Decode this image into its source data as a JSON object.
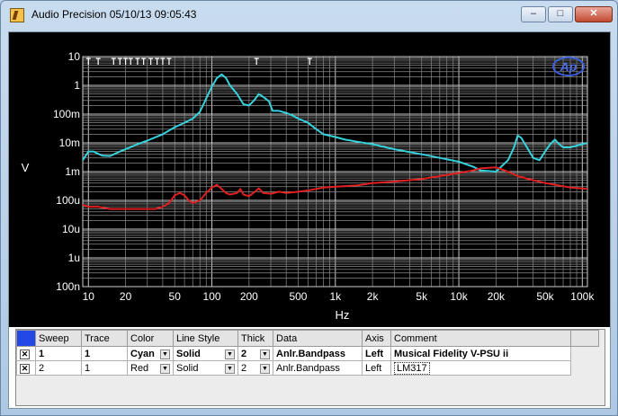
{
  "window": {
    "title": "Audio Precision  05/10/13 09:05:43",
    "minimize_glyph": "–",
    "maximize_glyph": "□",
    "close_glyph": "✕"
  },
  "plot": {
    "logo": "Ap"
  },
  "chart_data": {
    "type": "line",
    "title": "",
    "xlabel": "Hz",
    "ylabel": "V",
    "xscale": "log",
    "yscale": "log",
    "xlim": [
      9,
      110000
    ],
    "ylim": [
      1e-10,
      10
    ],
    "grid": true,
    "background": "#000000",
    "x_ticks": [
      {
        "value": 10,
        "label": "10"
      },
      {
        "value": 20,
        "label": "20"
      },
      {
        "value": 50,
        "label": "50"
      },
      {
        "value": 100,
        "label": "100"
      },
      {
        "value": 200,
        "label": "200"
      },
      {
        "value": 500,
        "label": "500"
      },
      {
        "value": 1000,
        "label": "1k"
      },
      {
        "value": 2000,
        "label": "2k"
      },
      {
        "value": 5000,
        "label": "5k"
      },
      {
        "value": 10000,
        "label": "10k"
      },
      {
        "value": 20000,
        "label": "20k"
      },
      {
        "value": 50000,
        "label": "50k"
      },
      {
        "value": 100000,
        "label": "100k"
      }
    ],
    "y_ticks": [
      {
        "value": 10,
        "label": "10"
      },
      {
        "value": 1,
        "label": "1"
      },
      {
        "value": 0.1,
        "label": "100m"
      },
      {
        "value": 0.01,
        "label": "10m"
      },
      {
        "value": 0.001,
        "label": "1m"
      },
      {
        "value": 0.0001,
        "label": "100u"
      },
      {
        "value": 1e-05,
        "label": "10u"
      },
      {
        "value": 1e-06,
        "label": "1u"
      },
      {
        "value": 1e-07,
        "label": "100n"
      }
    ],
    "markers_x": [
      10,
      12,
      16,
      18,
      20,
      22,
      25,
      28,
      32,
      36,
      40,
      45,
      230,
      620
    ],
    "series": [
      {
        "color": "#36d3dc",
        "points": [
          [
            9,
            0.0025
          ],
          [
            10,
            0.005
          ],
          [
            11,
            0.005
          ],
          [
            12,
            0.0042
          ],
          [
            13,
            0.0036
          ],
          [
            15,
            0.0035
          ],
          [
            17,
            0.0045
          ],
          [
            20,
            0.006
          ],
          [
            25,
            0.009
          ],
          [
            30,
            0.012
          ],
          [
            40,
            0.02
          ],
          [
            50,
            0.035
          ],
          [
            60,
            0.05
          ],
          [
            70,
            0.07
          ],
          [
            80,
            0.12
          ],
          [
            90,
            0.35
          ],
          [
            100,
            0.9
          ],
          [
            110,
            1.8
          ],
          [
            120,
            2.4
          ],
          [
            130,
            1.8
          ],
          [
            140,
            1.0
          ],
          [
            160,
            0.5
          ],
          [
            180,
            0.22
          ],
          [
            200,
            0.2
          ],
          [
            220,
            0.3
          ],
          [
            240,
            0.5
          ],
          [
            260,
            0.4
          ],
          [
            290,
            0.28
          ],
          [
            310,
            0.13
          ],
          [
            350,
            0.13
          ],
          [
            400,
            0.11
          ],
          [
            450,
            0.09
          ],
          [
            500,
            0.07
          ],
          [
            600,
            0.05
          ],
          [
            700,
            0.03
          ],
          [
            800,
            0.02
          ],
          [
            1000,
            0.016
          ],
          [
            1200,
            0.013
          ],
          [
            1500,
            0.011
          ],
          [
            2000,
            0.009
          ],
          [
            3000,
            0.006
          ],
          [
            5000,
            0.004
          ],
          [
            7000,
            0.003
          ],
          [
            10000,
            0.0022
          ],
          [
            13000,
            0.0015
          ],
          [
            15000,
            0.0011
          ],
          [
            20000,
            0.001
          ],
          [
            25000,
            0.0025
          ],
          [
            28000,
            0.007
          ],
          [
            30000,
            0.018
          ],
          [
            32000,
            0.015
          ],
          [
            35000,
            0.008
          ],
          [
            40000,
            0.003
          ],
          [
            45000,
            0.0025
          ],
          [
            50000,
            0.005
          ],
          [
            55000,
            0.009
          ],
          [
            60000,
            0.013
          ],
          [
            65000,
            0.009
          ],
          [
            70000,
            0.007
          ],
          [
            80000,
            0.007
          ],
          [
            90000,
            0.008
          ],
          [
            110000,
            0.01
          ]
        ]
      },
      {
        "color": "#e02020",
        "points": [
          [
            9,
            7e-05
          ],
          [
            10,
            6e-05
          ],
          [
            12,
            6e-05
          ],
          [
            15,
            5e-05
          ],
          [
            20,
            5e-05
          ],
          [
            25,
            5e-05
          ],
          [
            30,
            5e-05
          ],
          [
            35,
            5e-05
          ],
          [
            40,
            6e-05
          ],
          [
            45,
            8e-05
          ],
          [
            50,
            0.00015
          ],
          [
            55,
            0.00018
          ],
          [
            60,
            0.00015
          ],
          [
            65,
            0.0001
          ],
          [
            70,
            8e-05
          ],
          [
            80,
            0.0001
          ],
          [
            90,
            0.00018
          ],
          [
            100,
            0.00028
          ],
          [
            110,
            0.00035
          ],
          [
            120,
            0.00025
          ],
          [
            130,
            0.00018
          ],
          [
            140,
            0.00016
          ],
          [
            160,
            0.00018
          ],
          [
            170,
            0.00025
          ],
          [
            180,
            0.00016
          ],
          [
            200,
            0.00014
          ],
          [
            220,
            0.00019
          ],
          [
            240,
            0.00026
          ],
          [
            260,
            0.00018
          ],
          [
            300,
            0.00017
          ],
          [
            350,
            0.0002
          ],
          [
            400,
            0.00018
          ],
          [
            500,
            0.0002
          ],
          [
            600,
            0.00022
          ],
          [
            700,
            0.00025
          ],
          [
            800,
            0.00028
          ],
          [
            1000,
            0.0003
          ],
          [
            1500,
            0.00033
          ],
          [
            2000,
            0.0004
          ],
          [
            3000,
            0.00045
          ],
          [
            5000,
            0.00055
          ],
          [
            7000,
            0.0007
          ],
          [
            10000,
            0.0009
          ],
          [
            13000,
            0.0011
          ],
          [
            15000,
            0.0013
          ],
          [
            20000,
            0.0014
          ],
          [
            25000,
            0.001
          ],
          [
            30000,
            0.0007
          ],
          [
            40000,
            0.0005
          ],
          [
            50000,
            0.0004
          ],
          [
            60000,
            0.00035
          ],
          [
            80000,
            0.00028
          ],
          [
            110000,
            0.00025
          ]
        ]
      }
    ]
  },
  "trace_table": {
    "columns": [
      "Sweep",
      "Trace",
      "Color",
      "Line Style",
      "Thick",
      "Data",
      "Axis",
      "Comment"
    ],
    "rows": [
      {
        "checked": "✕",
        "sweep": "1",
        "trace": "1",
        "color": "Cyan",
        "line_style": "Solid",
        "thick": "2",
        "data": "Anlr.Bandpass",
        "axis": "Left",
        "comment": "Musical Fidelity V-PSU ii",
        "bold": true
      },
      {
        "checked": "✕",
        "sweep": "2",
        "trace": "1",
        "color": "Red",
        "line_style": "Solid",
        "thick": "2",
        "data": "Anlr.Bandpass",
        "axis": "Left",
        "comment": "LM317",
        "bold": false
      }
    ]
  }
}
